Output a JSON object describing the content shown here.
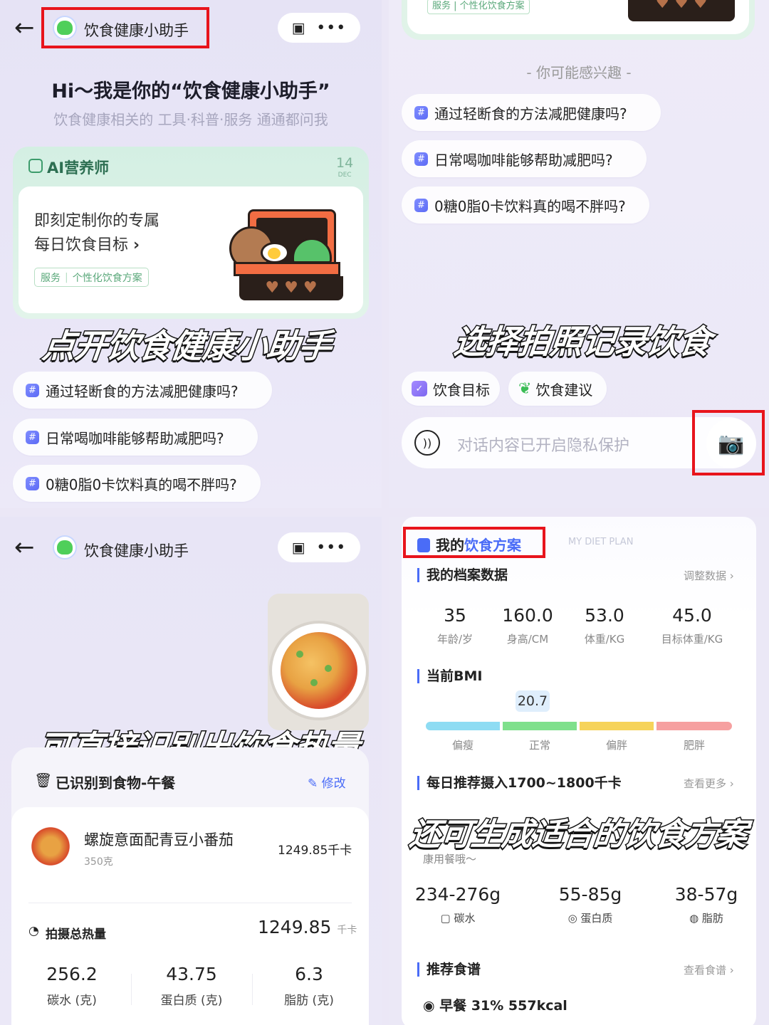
{
  "panel1": {
    "assistant_name": "饮食健康小助手",
    "greeting": "Hi～我是你的“饮食健康小助手”",
    "subtitle": "饮食健康相关的 工具·科普·服务 通通都问我",
    "ai_card": {
      "title": "AI营养师",
      "date_day": "14",
      "date_month": "DEC",
      "line1": "即刻定制你的专属",
      "line2": "每日饮食目标",
      "tag_service": "服务",
      "tag_plan": "个性化饮食方案"
    },
    "caption": "点开饮食健康小助手",
    "questions": [
      "通过轻断食的方法减肥健康吗?",
      "日常喝咖啡能够帮助减肥吗?",
      "0糖0脂0卡饮料真的喝不胖吗?"
    ]
  },
  "panel2": {
    "top_tag": "服务 | 个性化饮食方案",
    "interest_label": "- 你可能感兴趣 -",
    "questions": [
      "通过轻断食的方法减肥健康吗?",
      "日常喝咖啡能够帮助减肥吗?",
      "0糖0脂0卡饮料真的喝不胖吗?"
    ],
    "caption": "选择拍照记录饮食",
    "quick_actions": [
      "饮食目标",
      "饮食建议"
    ],
    "input_placeholder": "对话内容已开启隐私保护"
  },
  "panel3": {
    "assistant_name": "饮食健康小助手",
    "caption": "可直接识别出饮食热量",
    "recognized_title": "已识别到食物-午餐",
    "edit_label": "修改",
    "food": {
      "name": "螺旋意面配青豆小番茄",
      "weight": "350克",
      "calories": "1249.85千卡"
    },
    "total_label": "拍摄总热量",
    "total_value": "1249.85",
    "total_unit": "千卡",
    "macros": [
      {
        "value": "256.2",
        "label": "碳水 (克)"
      },
      {
        "value": "43.75",
        "label": "蛋白质 (克)"
      },
      {
        "value": "6.3",
        "label": "脂肪 (克)"
      }
    ]
  },
  "panel4": {
    "plan_title_a": "我的",
    "plan_title_b": "饮食方案",
    "plan_title_en": "MY DIET PLAN",
    "profile_title": "我的档案数据",
    "adjust_link": "调整数据",
    "profile": [
      {
        "value": "35",
        "label": "年龄/岁"
      },
      {
        "value": "160.0",
        "label": "身高/CM"
      },
      {
        "value": "53.0",
        "label": "体重/KG"
      },
      {
        "value": "45.0",
        "label": "目标体重/KG"
      }
    ],
    "bmi_title": "当前BMI",
    "bmi_value": "20.7",
    "bmi_ranges": [
      "偏瘦",
      "正常",
      "偏胖",
      "肥胖"
    ],
    "bmi_colors": [
      "#8edcf3",
      "#7fe08c",
      "#f6d35a",
      "#f6a0a0"
    ],
    "daily_title": "每日推荐摄入1700~1800千卡",
    "more_link": "查看更多",
    "caption": "还可生成适合的饮食方案",
    "healthy_text": "康用餐哦～",
    "nutrients": [
      {
        "value": "234-276g",
        "label": "碳水"
      },
      {
        "value": "55-85g",
        "label": "蛋白质"
      },
      {
        "value": "38-57g",
        "label": "脂肪"
      }
    ],
    "recipe_title": "推荐食谱",
    "recipe_link": "查看食谱",
    "breakfast": "早餐 31% 557kcal"
  }
}
